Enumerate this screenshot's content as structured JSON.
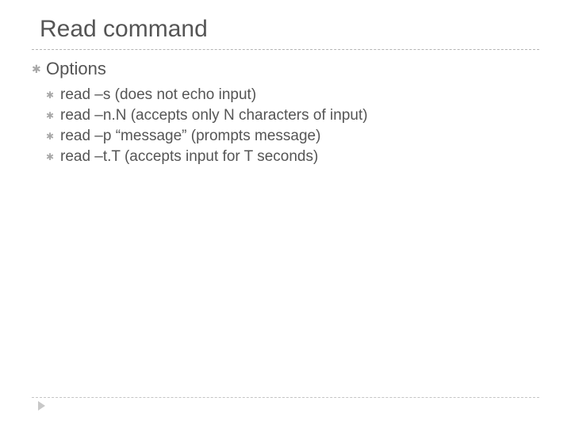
{
  "title": "Read command",
  "subtitle": "Options",
  "bullet_glyph": "✱",
  "items": [
    "read –s             (does not echo input)",
    "read –n.N (accepts only N characters of input)",
    "read –p “message”        (prompts message)",
    "read –t.T  (accepts input for T seconds)"
  ]
}
